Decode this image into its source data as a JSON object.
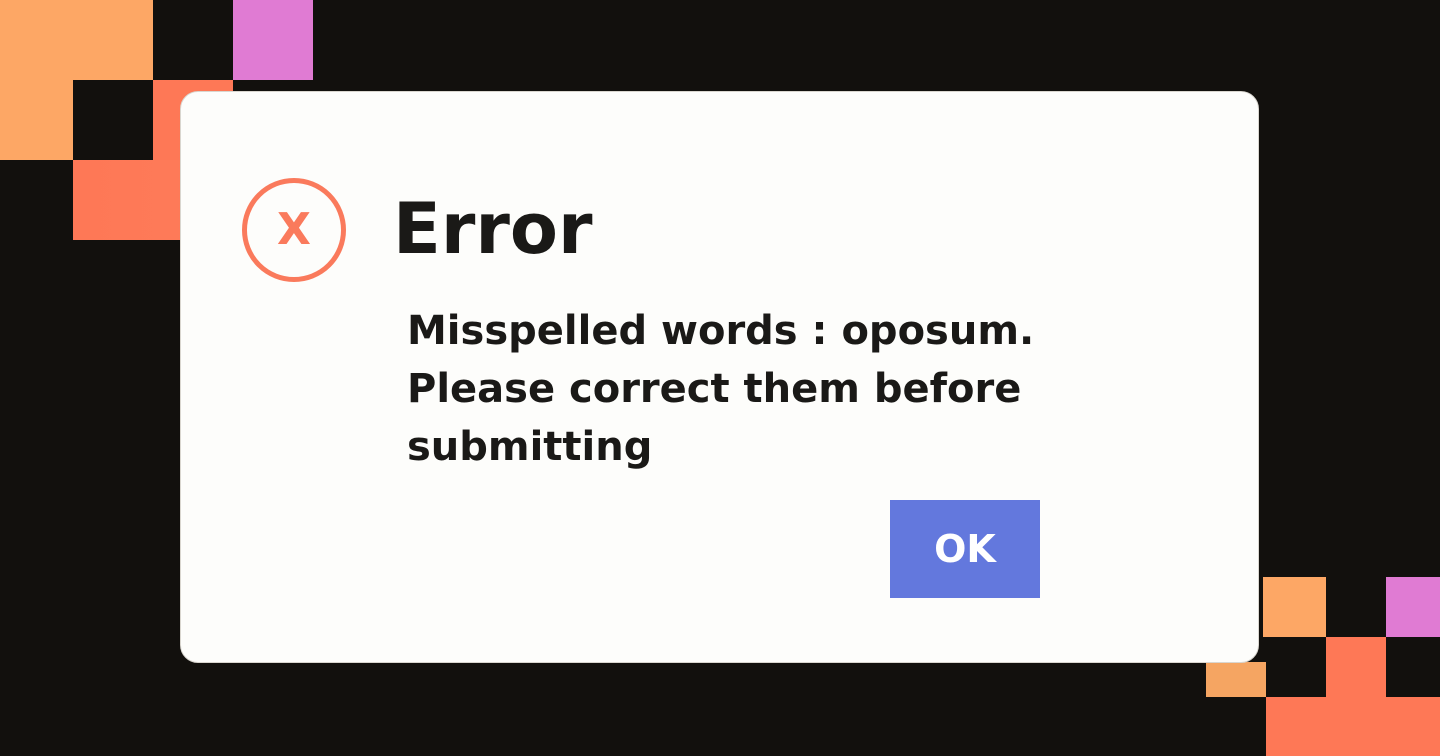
{
  "dialog": {
    "icon": "error-x-icon",
    "icon_glyph": "X",
    "title": "Error",
    "message": "Misspelled words : oposum. Please correct them before submitting",
    "ok_label": "OK"
  },
  "colors": {
    "background": "#12100d",
    "dialog_background": "#fdfdfb",
    "error_accent": "#fa7a5c",
    "button": "#6378dd",
    "decor_orange": "#fda765",
    "decor_coral": "#fe7856",
    "decor_pink": "#e07bd3"
  }
}
